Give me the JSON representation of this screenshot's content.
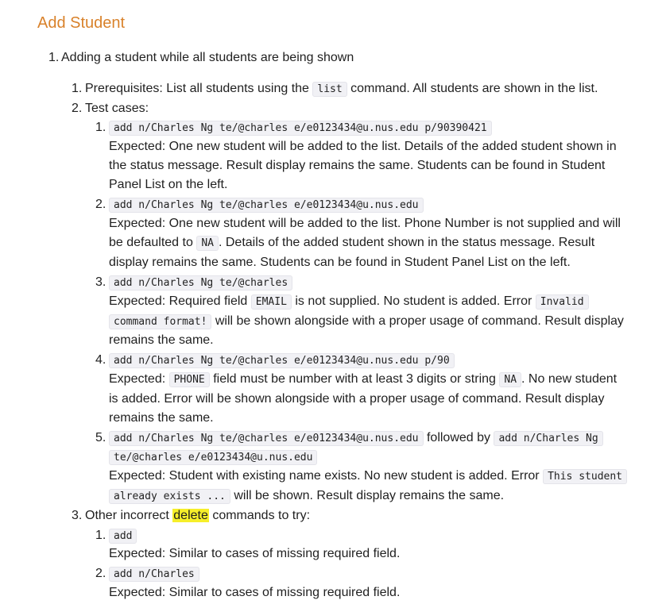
{
  "title": "Add Student",
  "top_item": {
    "num": "1.",
    "text": "Adding a student while all students are being shown"
  },
  "prereq": {
    "num": "1.",
    "pre": "Prerequisites: List all students using the",
    "code": "list",
    "post": "command. All students are shown in the list."
  },
  "testcases_label": {
    "num": "2.",
    "text": "Test cases:"
  },
  "tc1": {
    "num": "1.",
    "cmd": "add n/Charles Ng te/@charles e/e0123434@u.nus.edu p/90390421",
    "l1": "Expected: One new student will be added to the list. Details of the added student shown in",
    "l2": "the status message. Result display remains the same. Students can be found in Student",
    "l3": "Panel List on the left."
  },
  "tc2": {
    "num": "2.",
    "cmd": "add n/Charles Ng te/@charles e/e0123434@u.nus.edu",
    "l1": "Expected: One new student will be added to the list. Phone Number is not supplied and will",
    "l2_pre": "be defaulted to",
    "l2_code": "NA",
    "l2_post": ". Details of the added student shown in the status message. Result",
    "l3": "display remains the same. Students can be found in Student Panel List on the left."
  },
  "tc3": {
    "num": "3.",
    "cmd": "add n/Charles Ng te/@charles",
    "l1_pre": "Expected: Required field",
    "l1_code": "EMAIL",
    "l1_mid": "is not supplied. No student is added. Error",
    "l1_code2": "Invalid",
    "l2_code": "command format!",
    "l2_post": "will be shown alongside with a proper usage of command. Result display",
    "l3": "remains the same."
  },
  "tc4": {
    "num": "4.",
    "cmd": "add n/Charles Ng te/@charles e/e0123434@u.nus.edu p/90",
    "l1_pre": "Expected:",
    "l1_code": "PHONE",
    "l1_mid": "field must be number with at least 3 digits or string",
    "l1_code2": "NA",
    "l1_post": ". No new student",
    "l2": "is added. Error will be shown alongside with a proper usage of command. Result display",
    "l3": "remains the same."
  },
  "tc5": {
    "num": "5.",
    "cmd1": "add n/Charles Ng te/@charles e/e0123434@u.nus.edu",
    "followed": "followed by",
    "cmd2a": "add n/Charles Ng",
    "cmd2b": "te/@charles e/e0123434@u.nus.edu",
    "l1_pre": "Expected: Student with existing name exists. No new student is added. Error",
    "l1_code": "This student",
    "l2_code": "already exists ...",
    "l2_post": "will be shown. Result display remains the same."
  },
  "other": {
    "num": "3.",
    "pre": "Other incorrect",
    "highlight": "delete",
    "post": "commands to try:"
  },
  "o1": {
    "num": "1.",
    "cmd": "add",
    "expected": "Expected: Similar to cases of missing required field."
  },
  "o2": {
    "num": "2.",
    "cmd": "add n/Charles",
    "expected": "Expected: Similar to cases of missing required field."
  }
}
